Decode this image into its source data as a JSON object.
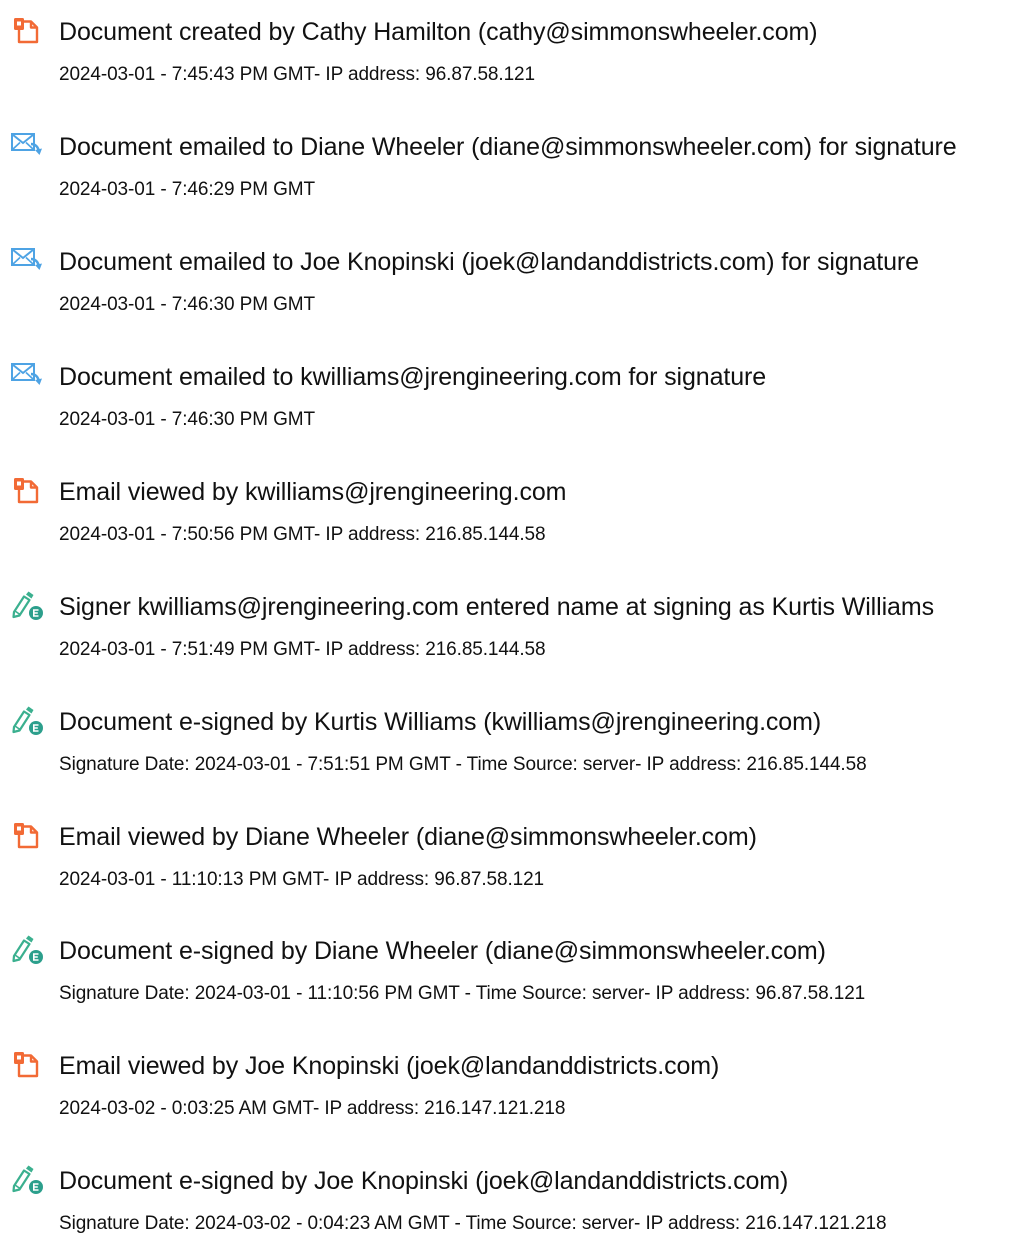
{
  "colors": {
    "document_icon": "#f26a35",
    "email_icon": "#4ea3e4",
    "sign_icon_pen": "#3bb08f",
    "sign_icon_badge": "#2c9f8c",
    "text": "#111111"
  },
  "events": [
    {
      "icon": "document-icon",
      "title": "Document created by Cathy Hamilton (cathy@simmonswheeler.com)",
      "detail": "2024-03-01 - 7:45:43 PM GMT- IP address: 96.87.58.121"
    },
    {
      "icon": "email-icon",
      "title": "Document emailed to Diane Wheeler (diane@simmonswheeler.com) for signature",
      "detail": "2024-03-01 - 7:46:29 PM GMT"
    },
    {
      "icon": "email-icon",
      "title": "Document emailed to Joe Knopinski (joek@landanddistricts.com) for signature",
      "detail": "2024-03-01 - 7:46:30 PM GMT"
    },
    {
      "icon": "email-icon",
      "title": "Document emailed to kwilliams@jrengineering.com for signature",
      "detail": "2024-03-01 - 7:46:30 PM GMT"
    },
    {
      "icon": "document-icon",
      "title": "Email viewed by kwilliams@jrengineering.com",
      "detail": "2024-03-01 - 7:50:56 PM GMT- IP address: 216.85.144.58"
    },
    {
      "icon": "sign-icon",
      "title": "Signer kwilliams@jrengineering.com entered name at signing as Kurtis Williams",
      "detail": "2024-03-01 - 7:51:49 PM GMT- IP address: 216.85.144.58"
    },
    {
      "icon": "sign-icon",
      "title": "Document e-signed by Kurtis Williams (kwilliams@jrengineering.com)",
      "detail": "Signature Date: 2024-03-01 - 7:51:51 PM GMT - Time Source: server- IP address: 216.85.144.58"
    },
    {
      "icon": "document-icon",
      "title": "Email viewed by Diane Wheeler (diane@simmonswheeler.com)",
      "detail": "2024-03-01 - 11:10:13 PM GMT- IP address: 96.87.58.121"
    },
    {
      "icon": "sign-icon",
      "title": "Document e-signed by Diane Wheeler (diane@simmonswheeler.com)",
      "detail": "Signature Date: 2024-03-01 - 11:10:56 PM GMT - Time Source: server- IP address: 96.87.58.121"
    },
    {
      "icon": "document-icon",
      "title": "Email viewed by Joe Knopinski (joek@landanddistricts.com)",
      "detail": "2024-03-02 - 0:03:25 AM GMT- IP address: 216.147.121.218"
    },
    {
      "icon": "sign-icon",
      "title": "Document e-signed by Joe Knopinski (joek@landanddistricts.com)",
      "detail": "Signature Date: 2024-03-02 - 0:04:23 AM GMT - Time Source: server- IP address: 216.147.121.218"
    }
  ]
}
